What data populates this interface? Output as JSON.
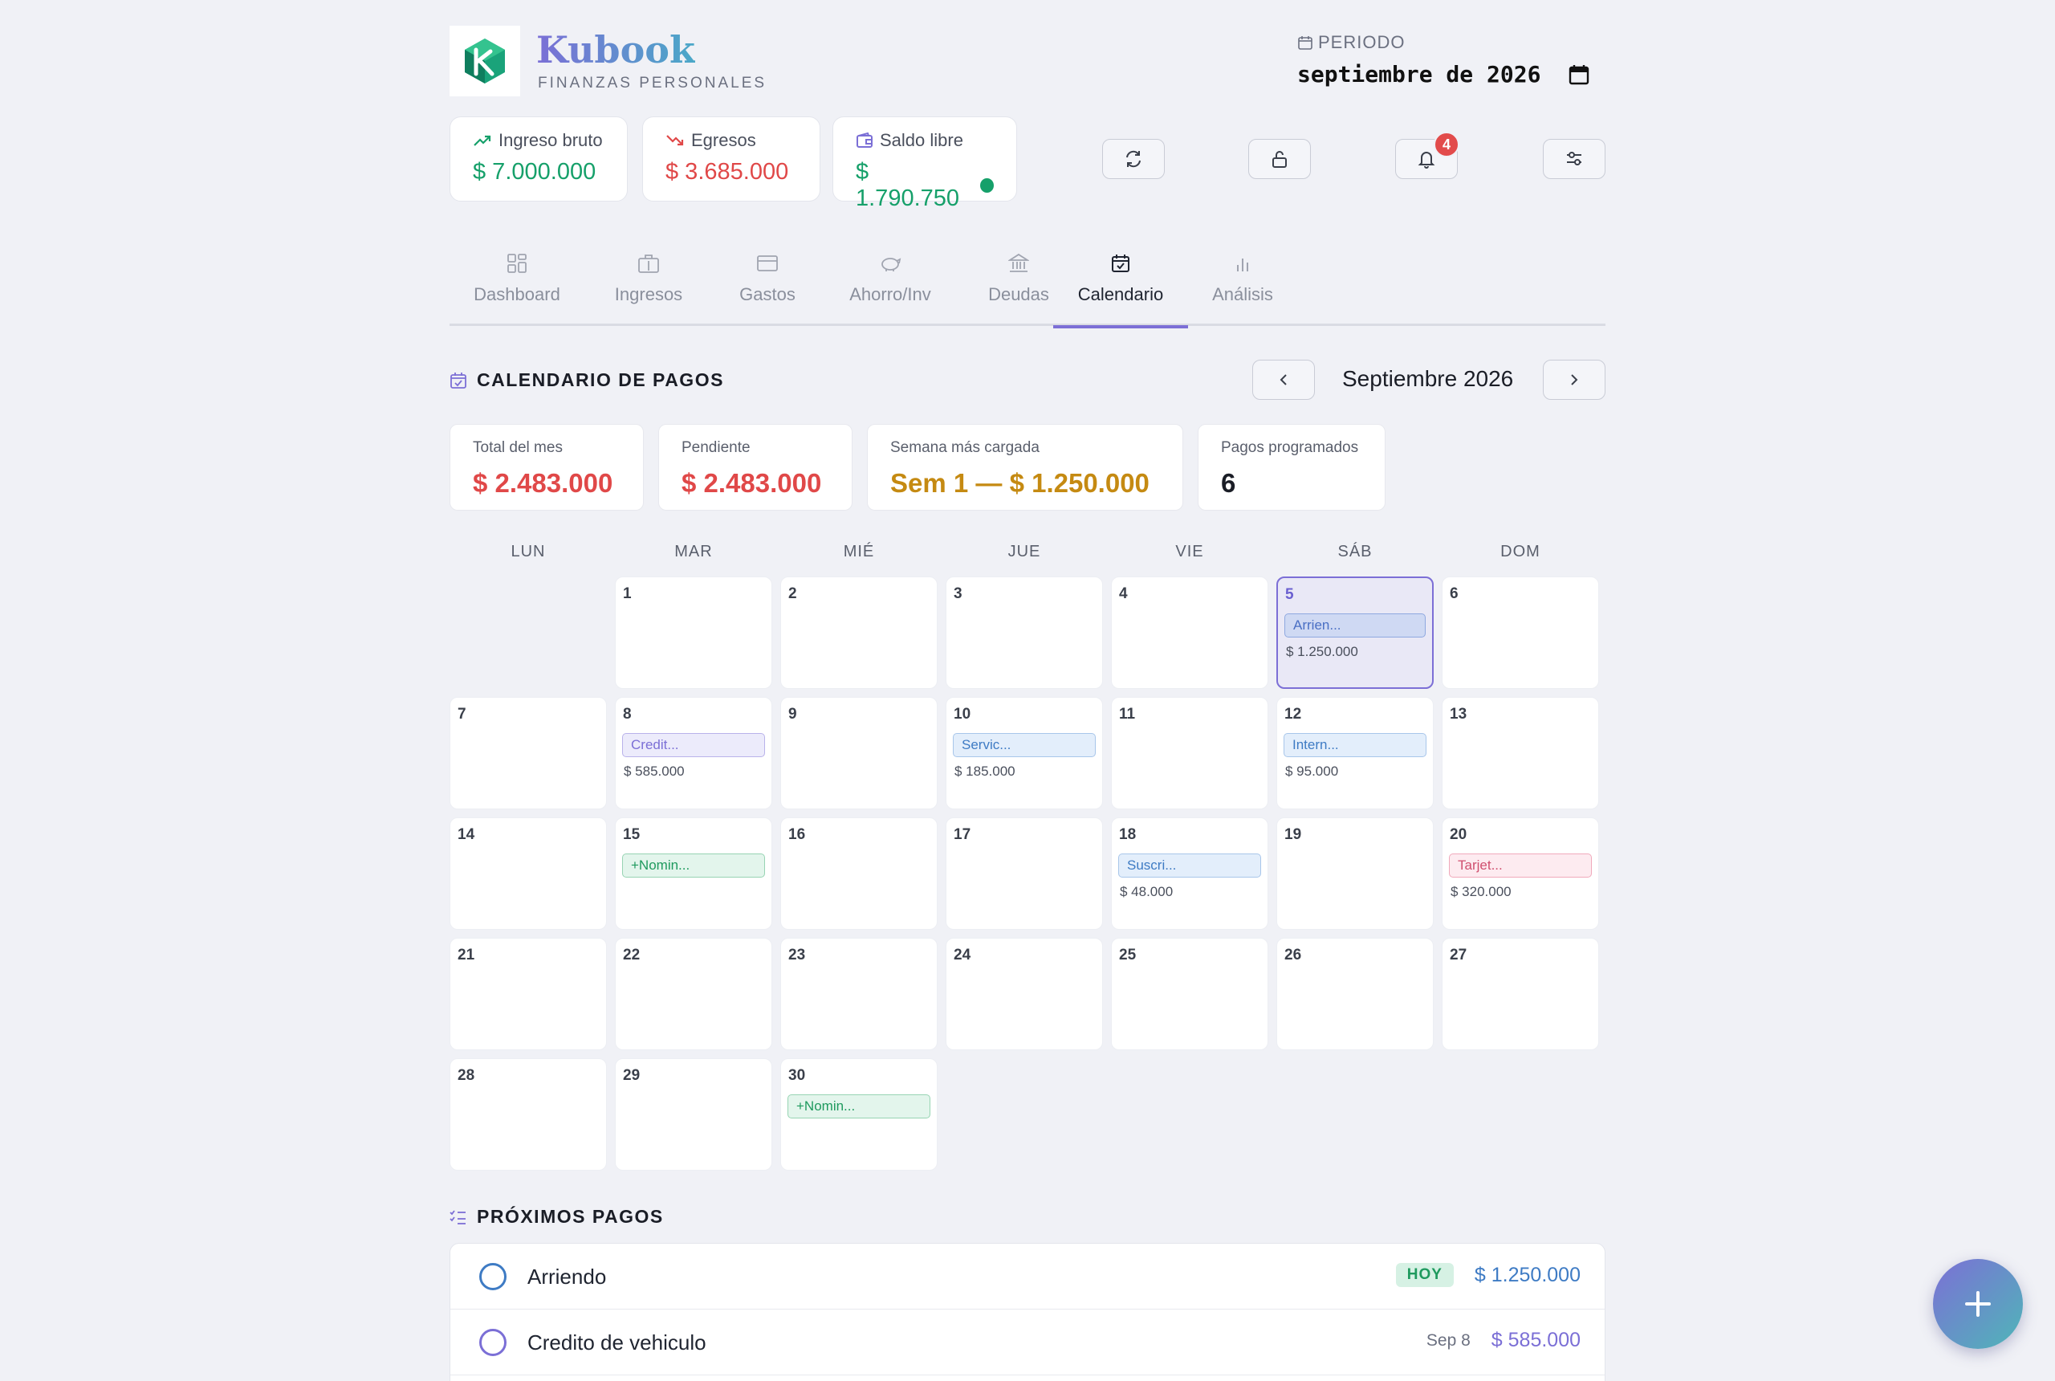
{
  "brand": {
    "name": "Kubook",
    "subtitle": "FINANZAS PERSONALES"
  },
  "period": {
    "label": "PERIODO",
    "value": "septiembre de 2026"
  },
  "summary": [
    {
      "label": "Ingreso bruto",
      "value": "$ 7.000.000",
      "color": "#16a06a",
      "icon": "trend-up-icon"
    },
    {
      "label": "Egresos",
      "value": "$ 3.685.000",
      "color": "#e04848",
      "icon": "trend-down-icon"
    },
    {
      "label": "Saldo libre",
      "value": "$ 1.790.750",
      "color": "#16a06a",
      "icon": "wallet-icon"
    }
  ],
  "notifications": {
    "count": "4"
  },
  "tabs": [
    {
      "label": "Dashboard",
      "icon": "grid-icon"
    },
    {
      "label": "Ingresos",
      "icon": "briefcase-icon"
    },
    {
      "label": "Gastos",
      "icon": "card-icon"
    },
    {
      "label": "Ahorro/Inv",
      "icon": "piggy-icon"
    },
    {
      "label": "Deudas",
      "icon": "bank-icon"
    },
    {
      "label": "Calendario",
      "icon": "calendar-check-icon",
      "active": true
    },
    {
      "label": "Análisis",
      "icon": "bar-chart-icon"
    }
  ],
  "calendar": {
    "title": "CALENDARIO DE PAGOS",
    "month": "Septiembre 2026",
    "stats": [
      {
        "label": "Total del mes",
        "value": "$ 2.483.000",
        "color": "#e04848"
      },
      {
        "label": "Pendiente",
        "value": "$ 2.483.000",
        "color": "#e04848"
      },
      {
        "label": "Semana más cargada",
        "value": "Sem 1 — $ 1.250.000",
        "color": "#c58a12"
      },
      {
        "label": "Pagos programados",
        "value": "6",
        "color": "#1a1d26"
      }
    ],
    "weekdays": [
      "LUN",
      "MAR",
      "MIÉ",
      "JUE",
      "VIE",
      "SÁB",
      "DOM"
    ],
    "days": [
      {
        "n": "1"
      },
      {
        "n": "2"
      },
      {
        "n": "3"
      },
      {
        "n": "4"
      },
      {
        "n": "5",
        "today": true,
        "chip": "Arrien...",
        "kind": "indigo",
        "amount": "$ 1.250.000"
      },
      {
        "n": "6"
      },
      {
        "n": "7"
      },
      {
        "n": "8",
        "chip": "Credit...",
        "kind": "purple",
        "amount": "$ 585.000"
      },
      {
        "n": "9"
      },
      {
        "n": "10",
        "chip": "Servic...",
        "kind": "blue",
        "amount": "$ 185.000"
      },
      {
        "n": "11"
      },
      {
        "n": "12",
        "chip": "Intern...",
        "kind": "blue",
        "amount": "$ 95.000"
      },
      {
        "n": "13"
      },
      {
        "n": "14"
      },
      {
        "n": "15",
        "chip": "+Nomin...",
        "kind": "green"
      },
      {
        "n": "16"
      },
      {
        "n": "17"
      },
      {
        "n": "18",
        "chip": "Suscri...",
        "kind": "blue",
        "amount": "$ 48.000"
      },
      {
        "n": "19"
      },
      {
        "n": "20",
        "chip": "Tarjet...",
        "kind": "pink",
        "amount": "$ 320.000"
      },
      {
        "n": "21"
      },
      {
        "n": "22"
      },
      {
        "n": "23"
      },
      {
        "n": "24"
      },
      {
        "n": "25"
      },
      {
        "n": "26"
      },
      {
        "n": "27"
      },
      {
        "n": "28"
      },
      {
        "n": "29"
      },
      {
        "n": "30",
        "chip": "+Nomin...",
        "kind": "green"
      }
    ]
  },
  "upcoming": {
    "title": "PRÓXIMOS PAGOS",
    "items": [
      {
        "name": "Arriendo",
        "tag": "HOY",
        "date": "",
        "amount": "$ 1.250.000",
        "color": "#3e7bc4"
      },
      {
        "name": "Credito de vehiculo",
        "tag": "",
        "date": "Sep 8",
        "amount": "$ 585.000",
        "color": "#7b6fd6"
      }
    ]
  }
}
